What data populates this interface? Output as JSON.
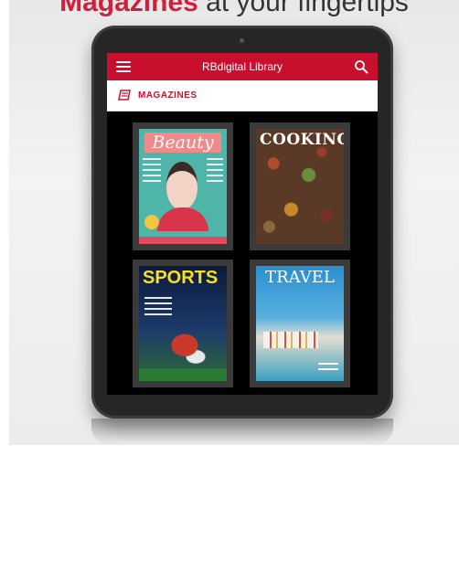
{
  "promo": {
    "headline_accent": "Magazines",
    "headline_rest": "at your fingertips"
  },
  "app": {
    "title": "RBdigital Library",
    "section": "MAGAZINES",
    "accent_color": "#c8102e"
  },
  "icons": {
    "menu": "hamburger-menu-icon",
    "search": "search-icon",
    "section": "magazine-icon"
  },
  "magazines": [
    {
      "title": "Beauty"
    },
    {
      "title": "COOKING"
    },
    {
      "title": "SPORTS"
    },
    {
      "title": "TRAVEL"
    }
  ]
}
